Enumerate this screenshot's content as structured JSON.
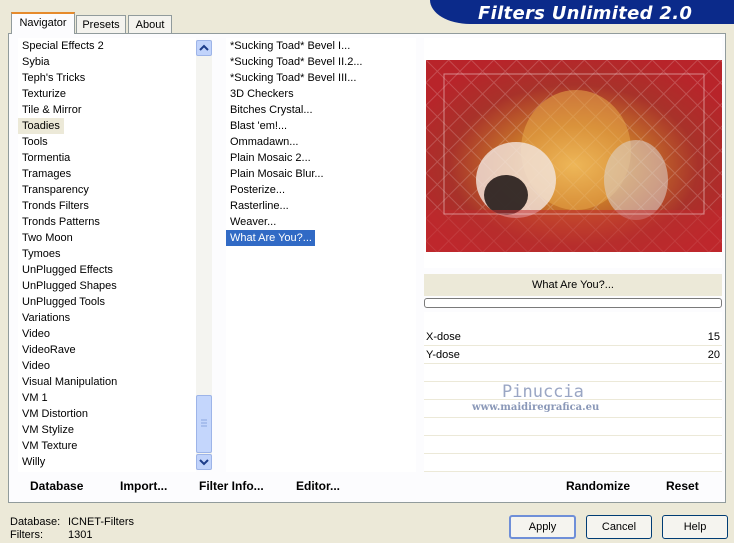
{
  "tabs": [
    {
      "label": "Navigator",
      "active": true
    },
    {
      "label": "Presets",
      "active": false
    },
    {
      "label": "About",
      "active": false
    }
  ],
  "banner": {
    "title": "Filters Unlimited 2.0"
  },
  "categories": [
    {
      "label": "Special Effects 2"
    },
    {
      "label": "Sybia"
    },
    {
      "label": "Teph's Tricks"
    },
    {
      "label": "Texturize"
    },
    {
      "label": "Tile & Mirror"
    },
    {
      "label": "Toadies",
      "selected": true
    },
    {
      "label": "Tools"
    },
    {
      "label": "Tormentia"
    },
    {
      "label": "Tramages"
    },
    {
      "label": "Transparency"
    },
    {
      "label": "Tronds Filters"
    },
    {
      "label": "Tronds Patterns"
    },
    {
      "label": "Two Moon"
    },
    {
      "label": "Tymoes"
    },
    {
      "label": "UnPlugged Effects"
    },
    {
      "label": "UnPlugged Shapes"
    },
    {
      "label": "UnPlugged Tools"
    },
    {
      "label": "Variations"
    },
    {
      "label": "Video"
    },
    {
      "label": "VideoRave"
    },
    {
      "label": "Video"
    },
    {
      "label": "Visual Manipulation"
    },
    {
      "label": "VM 1"
    },
    {
      "label": "VM Distortion"
    },
    {
      "label": "VM Stylize"
    },
    {
      "label": "VM Texture"
    },
    {
      "label": "Willy"
    }
  ],
  "filters": [
    {
      "label": "*Sucking Toad*  Bevel I..."
    },
    {
      "label": "*Sucking Toad*  Bevel II.2..."
    },
    {
      "label": "*Sucking Toad*  Bevel III..."
    },
    {
      "label": "3D Checkers"
    },
    {
      "label": "Bitches Crystal..."
    },
    {
      "label": "Blast 'em!..."
    },
    {
      "label": "Ommadawn..."
    },
    {
      "label": "Plain Mosaic 2..."
    },
    {
      "label": "Plain Mosaic Blur..."
    },
    {
      "label": "Posterize..."
    },
    {
      "label": "Rasterline..."
    },
    {
      "label": "Weaver..."
    },
    {
      "label": "What Are You?...",
      "selected": true
    }
  ],
  "selected_filter_name": "What Are You?...",
  "controls": [
    {
      "label": "X-dose",
      "value": "15"
    },
    {
      "label": "Y-dose",
      "value": "20"
    }
  ],
  "watermark": {
    "name": "Pinuccia",
    "url": "www.maidiregrafica.eu"
  },
  "panel_buttons": {
    "database": "Database",
    "import": "Import...",
    "filter_info": "Filter Info...",
    "editor": "Editor...",
    "randomize": "Randomize",
    "reset": "Reset"
  },
  "status": {
    "database_label": "Database:",
    "database_value": "ICNET-Filters",
    "filters_label": "Filters:",
    "filters_value": "1301"
  },
  "dialog_buttons": {
    "apply": "Apply",
    "cancel": "Cancel",
    "help": "Help"
  },
  "colors": {
    "banner": "#0b2a8a",
    "selection": "#316ac5",
    "tab_highlight": "#e68b2c",
    "dialog_bg": "#ece9d8"
  }
}
